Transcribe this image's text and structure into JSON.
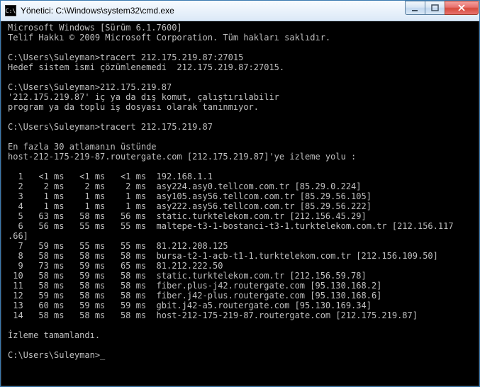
{
  "window": {
    "title": "Yönetici: C:\\Windows\\system32\\cmd.exe",
    "icon_glyph": "C:\\"
  },
  "console": {
    "os_line": "Microsoft Windows [Sürüm 6.1.7600]",
    "copyright": "Telif Hakkı © 2009 Microsoft Corporation. Tüm hakları saklıdır.",
    "prompt": "C:\\Users\\Suleyman>",
    "cmd1": "tracert 212.175.219.87:27015",
    "err1": "Hedef sistem ismi çözümlenemedi  212.175.219.87:27015.",
    "cmd2": "212.175.219.87",
    "err2a": "'212.175.219.87' iç ya da dış komut, çalıştırılabilir",
    "err2b": "program ya da toplu iş dosyası olarak tanınmıyor.",
    "cmd3": "tracert 212.175.219.87",
    "trace_header_a": "En fazla 30 atlamanın üstünde",
    "trace_header_b": "host-212-175-219-87.routergate.com [212.175.219.87]'ye izleme yolu :",
    "hops": [
      {
        "n": "1",
        "t1": "<1 ms",
        "t2": "<1 ms",
        "t3": "<1 ms",
        "host": "192.168.1.1"
      },
      {
        "n": "2",
        "t1": "2 ms",
        "t2": "2 ms",
        "t3": "2 ms",
        "host": "asy224.asy0.tellcom.com.tr [85.29.0.224]"
      },
      {
        "n": "3",
        "t1": "1 ms",
        "t2": "1 ms",
        "t3": "1 ms",
        "host": "asy105.asy56.tellcom.com.tr [85.29.56.105]"
      },
      {
        "n": "4",
        "t1": "1 ms",
        "t2": "1 ms",
        "t3": "1 ms",
        "host": "asy222.asy56.tellcom.com.tr [85.29.56.222]"
      },
      {
        "n": "5",
        "t1": "63 ms",
        "t2": "58 ms",
        "t3": "56 ms",
        "host": "static.turktelekom.com.tr [212.156.45.29]"
      },
      {
        "n": "6",
        "t1": "56 ms",
        "t2": "55 ms",
        "t3": "55 ms",
        "host": "maltepe-t3-1-bostanci-t3-1.turktelekom.com.tr [212.156.117.66]",
        "wrap": true
      },
      {
        "n": "7",
        "t1": "59 ms",
        "t2": "55 ms",
        "t3": "55 ms",
        "host": "81.212.208.125"
      },
      {
        "n": "8",
        "t1": "58 ms",
        "t2": "58 ms",
        "t3": "58 ms",
        "host": "bursa-t2-1-acb-t1-1.turktelekom.com.tr [212.156.109.50]",
        "wrap": true
      },
      {
        "n": "9",
        "t1": "73 ms",
        "t2": "59 ms",
        "t3": "65 ms",
        "host": "81.212.222.50"
      },
      {
        "n": "10",
        "t1": "58 ms",
        "t2": "59 ms",
        "t3": "58 ms",
        "host": "static.turktelekom.com.tr [212.156.59.78]"
      },
      {
        "n": "11",
        "t1": "58 ms",
        "t2": "58 ms",
        "t3": "58 ms",
        "host": "fiber.plus-j42.routergate.com [95.130.168.2]"
      },
      {
        "n": "12",
        "t1": "59 ms",
        "t2": "58 ms",
        "t3": "58 ms",
        "host": "fiber.j42-plus.routergate.com [95.130.168.6]"
      },
      {
        "n": "13",
        "t1": "60 ms",
        "t2": "59 ms",
        "t3": "59 ms",
        "host": "gbit.j42-a5.routergate.com [95.130.169.34]"
      },
      {
        "n": "14",
        "t1": "58 ms",
        "t2": "58 ms",
        "t3": "58 ms",
        "host": "host-212-175-219-87.routergate.com [212.175.219.87]",
        "wrap": true
      }
    ],
    "trace_done": "İzleme tamamlandı.",
    "cursor": "_"
  }
}
